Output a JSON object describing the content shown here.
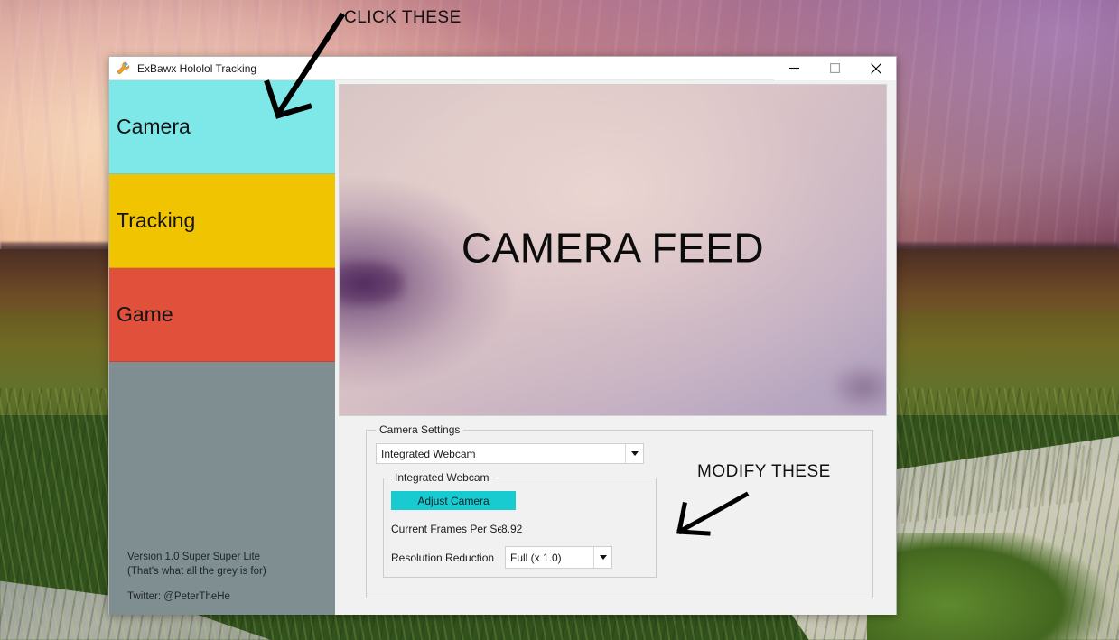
{
  "window": {
    "title": "ExBawx Hololol Tracking",
    "icon": "wrench-icon",
    "controls": {
      "minimize": "minimize-icon",
      "maximize": "maximize-icon",
      "close": "close-icon"
    }
  },
  "sidebar": {
    "tabs": [
      {
        "label": "Camera",
        "color": "#7ee8e8",
        "active": true
      },
      {
        "label": "Tracking",
        "color": "#f0c400",
        "active": false
      },
      {
        "label": "Game",
        "color": "#e0503a",
        "active": false
      }
    ],
    "background_color": "#7f8f91",
    "footer": {
      "version": "Version 1.0 Super Super Lite",
      "version_note": "(That's what all the grey is for)",
      "twitter": "Twitter: @PeterTheHe"
    }
  },
  "camera_feed": {
    "label": "CAMERA FEED"
  },
  "camera_settings": {
    "group_label": "Camera Settings",
    "device_combo": {
      "value": "Integrated Webcam",
      "arrow": "chevron-down-icon"
    },
    "device_group_label": "Integrated Webcam",
    "adjust_camera_label": "Adjust Camera",
    "adjust_camera_color": "#18cbd0",
    "fps_label": "Current Frames Per Seconc",
    "fps_value": "8.92",
    "resolution_label": "Resolution Reduction",
    "resolution_combo": {
      "value": "Full (x 1.0)",
      "arrow": "chevron-down-icon"
    }
  },
  "annotations": {
    "click_these": "CLICK THESE",
    "modify_these": "MODIFY THESE"
  }
}
